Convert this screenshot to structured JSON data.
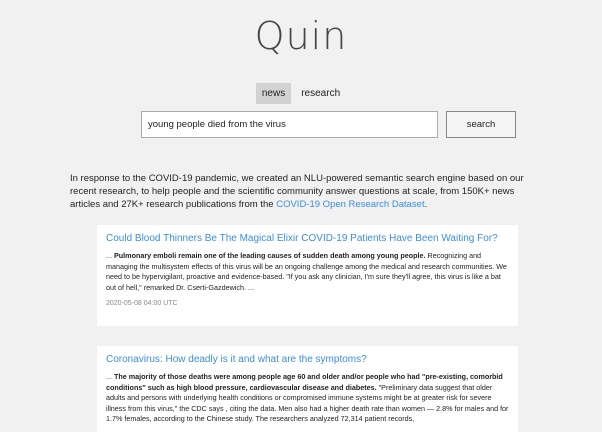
{
  "header": {
    "logo": "Quin"
  },
  "tabs": [
    {
      "label": "news",
      "active": true
    },
    {
      "label": "research",
      "active": false
    }
  ],
  "search": {
    "value": "young people died from the virus",
    "button_label": "search"
  },
  "intro": {
    "text_before": "In response to the COVID-19 pandemic, we created an NLU-powered semantic search engine based on our recent research, to help people and the scientific community answer questions at scale, from 150K+ news articles and 27K+ research publications from the ",
    "link_text": "COVID-19 Open Research Dataset",
    "text_after": "."
  },
  "results": [
    {
      "title": "Could Blood Thinners Be The Magical Elixir COVID-19 Patients Have Been Waiting For?",
      "snippet_prefix": "... ",
      "snippet_bold": "Pulmonary emboli remain one of the leading causes of sudden death among young people.",
      "snippet_rest": " Recognizing and managing the multisystem effects of this virus will be an ongoing challenge among the medical and research communities. We need to be hypervigilant, proactive and evidence-based. \"If you ask any clinician, I'm sure they'll agree, this virus is like a bat out of hell,\" remarked Dr. Cserti-Gazdewich. ...",
      "date": "2020-05-08 04:00 UTC"
    },
    {
      "title": "Coronavirus: How deadly is it and what are the symptoms?",
      "snippet_prefix": "... ",
      "snippet_bold": "The majority of those deaths were among people age 60 and older and/or people who had \"pre-existing, comorbid conditions\" such as high blood pressure, cardiovascular disease and diabetes.",
      "snippet_rest": " \"Preliminary data suggest that older adults and persons with underlying health conditions or compromised immune systems might be at greater risk for severe illness from this virus,\" the CDC says , citing the data. Men also had a higher death rate than women — 2.8% for males and for 1.7% females, according to the Chinese study. The researchers analyzed 72,314 patient records,",
      "date": ""
    }
  ]
}
